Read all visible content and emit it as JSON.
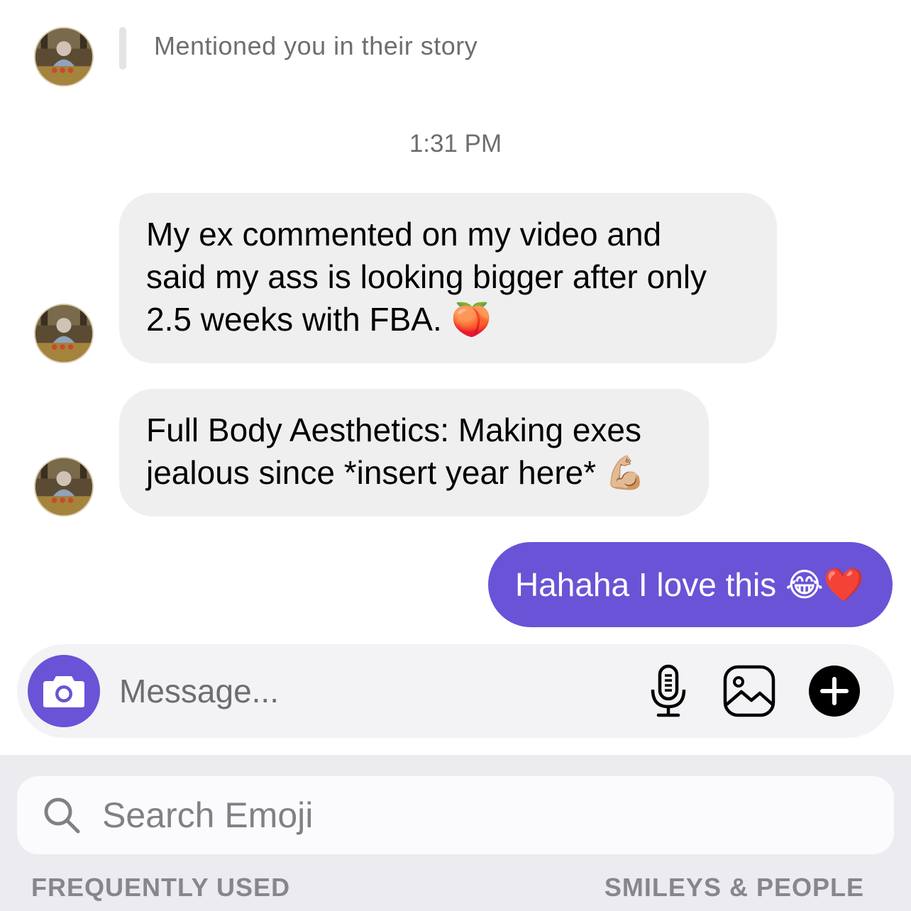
{
  "story": {
    "text": "Mentioned you in their story"
  },
  "timestamp": "1:31 PM",
  "messages": [
    {
      "line1": "My ex commented on my video and",
      "line2": "said my ass is looking bigger after only",
      "line3": "2.5 weeks with FBA.",
      "emoji": "🍑"
    },
    {
      "line1": "Full Body Aesthetics: Making exes",
      "line2": "jealous since *insert year here*",
      "emoji": "💪🏼"
    }
  ],
  "sent": {
    "text": "Hahaha I love this",
    "emoji": "😂❤️"
  },
  "composer": {
    "placeholder": "Message...",
    "icons": [
      "camera-icon",
      "microphone-icon",
      "gallery-icon",
      "plus-icon"
    ]
  },
  "emoji_keyboard": {
    "search_placeholder": "Search Emoji",
    "categories": [
      "FREQUENTLY USED",
      "SMILEYS & PEOPLE"
    ]
  },
  "colors": {
    "accent": "#6a53d6",
    "bubble_in": "#efefef",
    "muted_text": "#6d6d72"
  }
}
